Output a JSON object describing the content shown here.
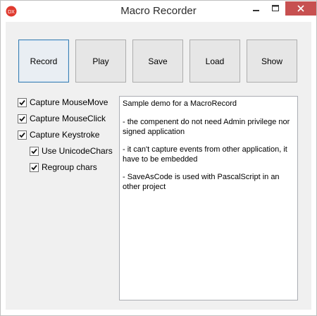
{
  "window": {
    "title": "Macro Recorder",
    "app_icon": "DX"
  },
  "toolbar": {
    "record": "Record",
    "play": "Play",
    "save": "Save",
    "load": "Load",
    "show": "Show"
  },
  "options": {
    "capture_mouse_move": {
      "label": "Capture MouseMove",
      "checked": true
    },
    "capture_mouse_click": {
      "label": "Capture MouseClick",
      "checked": true
    },
    "capture_keystroke": {
      "label": "Capture Keystroke",
      "checked": true
    },
    "use_unicode_chars": {
      "label": "Use UnicodeChars",
      "checked": true
    },
    "regroup_chars": {
      "label": "Regroup chars",
      "checked": true
    }
  },
  "memo": {
    "lines": [
      "Sample demo for a MacroRecord",
      "- the compenent do not need Admin privilege nor signed application",
      "- it can't capture events from other application, it have to be embedded",
      "- SaveAsCode is used with PascalScript in an other project"
    ]
  },
  "colors": {
    "close_button": "#c75050",
    "default_button_border": "#3c7fb1"
  }
}
